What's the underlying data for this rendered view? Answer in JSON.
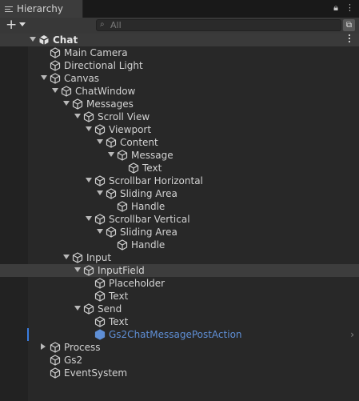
{
  "window": {
    "tab_label": "Hierarchy"
  },
  "toolbar": {
    "search_placeholder": "All"
  },
  "tree": [
    {
      "label": "Chat",
      "depth": 0,
      "toggle": "open",
      "type": "scene"
    },
    {
      "label": "Main Camera",
      "depth": 1,
      "toggle": "none",
      "type": "object"
    },
    {
      "label": "Directional Light",
      "depth": 1,
      "toggle": "none",
      "type": "object"
    },
    {
      "label": "Canvas",
      "depth": 1,
      "toggle": "open",
      "type": "object"
    },
    {
      "label": "ChatWindow",
      "depth": 2,
      "toggle": "open",
      "type": "object"
    },
    {
      "label": "Messages",
      "depth": 3,
      "toggle": "open",
      "type": "object"
    },
    {
      "label": "Scroll View",
      "depth": 4,
      "toggle": "open",
      "type": "object"
    },
    {
      "label": "Viewport",
      "depth": 5,
      "toggle": "open",
      "type": "object"
    },
    {
      "label": "Content",
      "depth": 6,
      "toggle": "open",
      "type": "object"
    },
    {
      "label": "Message",
      "depth": 7,
      "toggle": "open",
      "type": "object"
    },
    {
      "label": "Text",
      "depth": 8,
      "toggle": "none",
      "type": "object"
    },
    {
      "label": "Scrollbar Horizontal",
      "depth": 5,
      "toggle": "open",
      "type": "object"
    },
    {
      "label": "Sliding Area",
      "depth": 6,
      "toggle": "open",
      "type": "object"
    },
    {
      "label": "Handle",
      "depth": 7,
      "toggle": "none",
      "type": "object"
    },
    {
      "label": "Scrollbar Vertical",
      "depth": 5,
      "toggle": "open",
      "type": "object"
    },
    {
      "label": "Sliding Area",
      "depth": 6,
      "toggle": "open",
      "type": "object"
    },
    {
      "label": "Handle",
      "depth": 7,
      "toggle": "none",
      "type": "object"
    },
    {
      "label": "Input",
      "depth": 3,
      "toggle": "open",
      "type": "object"
    },
    {
      "label": "InputField",
      "depth": 4,
      "toggle": "open",
      "type": "object",
      "hover": true
    },
    {
      "label": "Placeholder",
      "depth": 5,
      "toggle": "none",
      "type": "object"
    },
    {
      "label": "Text",
      "depth": 5,
      "toggle": "none",
      "type": "object"
    },
    {
      "label": "Send",
      "depth": 4,
      "toggle": "open",
      "type": "object"
    },
    {
      "label": "Text",
      "depth": 5,
      "toggle": "none",
      "type": "object"
    },
    {
      "label": "Gs2ChatMessagePostAction",
      "depth": 5,
      "toggle": "none",
      "type": "prefab"
    },
    {
      "label": "Process",
      "depth": 1,
      "toggle": "closed",
      "type": "object"
    },
    {
      "label": "Gs2",
      "depth": 1,
      "toggle": "none",
      "type": "object"
    },
    {
      "label": "EventSystem",
      "depth": 1,
      "toggle": "none",
      "type": "object"
    }
  ]
}
